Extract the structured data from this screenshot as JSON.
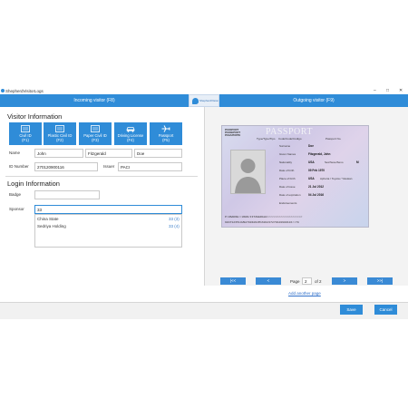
{
  "window": {
    "app_title": "ShepherdVisitorLogs",
    "minimize": "–",
    "maximize": "□",
    "close": "✕"
  },
  "tabs": {
    "incoming": "Incoming visitor (F8)",
    "outgoing": "Outgoing visitor (F9)"
  },
  "logo": {
    "text": "ShepherdVision"
  },
  "visitor_info": {
    "heading": "Visitor Information",
    "id_buttons": [
      {
        "label": "Civil ID",
        "key": "(F1)",
        "icon": "id-card-icon"
      },
      {
        "label": "Plastic Civil ID",
        "key": "(F2)",
        "icon": "id-card-icon"
      },
      {
        "label": "Paper Civil ID",
        "key": "(F3)",
        "icon": "id-card-icon"
      },
      {
        "label": "Driving License",
        "key": "(F4)",
        "icon": "car-icon"
      },
      {
        "label": "Passport",
        "key": "(F5)",
        "icon": "plane-icon"
      }
    ],
    "name_label": "Name",
    "first_name": "John",
    "middle_name": "Fitzgerald",
    "last_name": "Doe",
    "id_number_label": "ID Number",
    "id_number": "270120900116",
    "issuer_label": "Issuer",
    "issuer": "PACI"
  },
  "login_info": {
    "heading": "Login Information",
    "badge_label": "Badge",
    "badge_value": "",
    "sponsor_label": "Sponsor",
    "sponsor_value": "33",
    "suggestions": [
      {
        "name": "China State",
        "code": "33 (3)"
      },
      {
        "name": "Sedriya Holding",
        "code": "33 (4)"
      }
    ]
  },
  "passport": {
    "header_small": "PASSPORT\nPASSEPORT\nPASAPORTE",
    "title": "PASSPORT",
    "type_label": "Type/Type/Tipo",
    "code_label": "Code/Code/Código",
    "number_label": "Passport No.",
    "surname_label": "Surname",
    "surname": "Doe",
    "given_label": "Given Names",
    "given": "Fitzgerald, John",
    "nationality_label": "Nationality",
    "nationality": "USA",
    "sex_label": "Sex/Sexe/Sexo",
    "sex": "M",
    "dob_label": "Date of birth",
    "dob": "09 Feb 1970",
    "pob_label": "Place of birth",
    "pob": "USA",
    "pob_extra": "Aphoria / Toyota / Yokokan",
    "issue_label": "Date of issue",
    "issue": "21 Jul 2012",
    "expiry_label": "Date of expiration",
    "expiry": "04 Jul 2016",
    "endorse_label": "Endorsements",
    "mrz1": "P<USADOE<<JOHN<FITZGERALD<<<<<<<<<<<<<<<<<<<<<",
    "mrz2": "9047123514USA7001091M1601237270120900116<<78"
  },
  "pager": {
    "first": "|<<",
    "prev": "<",
    "page_label": "Page",
    "page": "2",
    "of_label": "of",
    "total": "2",
    "next": ">",
    "last": ">>|",
    "add_page": "Add another page"
  },
  "footer": {
    "save": "Save",
    "cancel": "Cancel"
  },
  "colors": {
    "accent": "#2f8cd8"
  }
}
